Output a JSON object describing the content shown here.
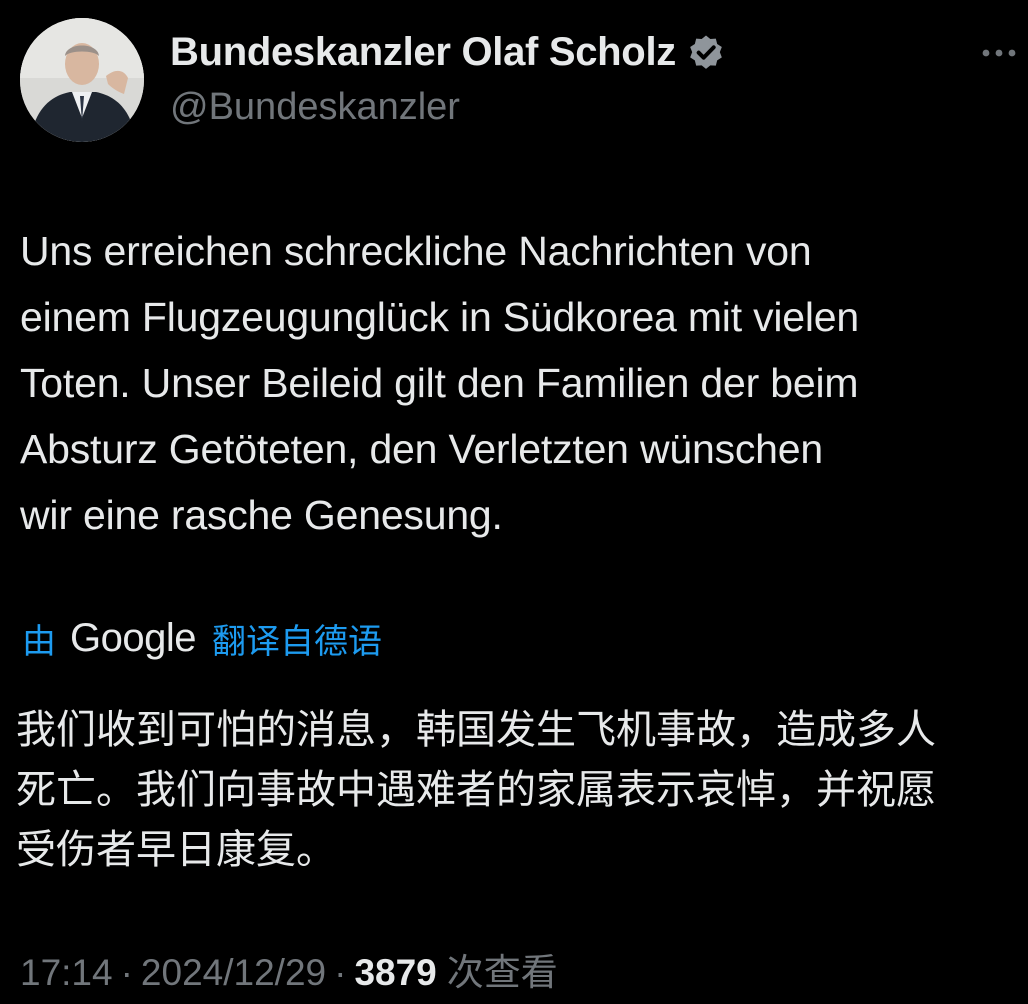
{
  "author": {
    "display_name": "Bundeskanzler Olaf Scholz",
    "handle": "@Bundeskanzler",
    "verified": true,
    "avatar_icon": "person-photo",
    "verified_icon": "verified-badge-icon"
  },
  "more_icon": "ellipsis-icon",
  "tweet": {
    "lines": [
      "Uns erreichen schreckliche Nachrichten von",
      "einem Flugzeugunglück in Südkorea mit vielen",
      "Toten. Unser Beileid gilt den Familien der beim",
      "Absturz Getöteten, den Verletzten wünschen",
      "wir eine rasche Genesung."
    ]
  },
  "translation": {
    "by_label": "由",
    "provider": "Google",
    "from_label": "翻译自德语",
    "lines": [
      "我们收到可怕的消息，韩国发生飞机事故，造成多人",
      "死亡。我们向事故中遇难者的家属表示哀悼，并祝愿",
      "受伤者早日康复。"
    ]
  },
  "meta": {
    "time": "17:14",
    "separator": "·",
    "date": "2024/12/29",
    "views_count": "3879",
    "views_label": "次查看"
  },
  "colors": {
    "background": "#000000",
    "text_primary": "#e7e9ea",
    "text_secondary": "#71767b",
    "accent": "#1d9bf0"
  }
}
